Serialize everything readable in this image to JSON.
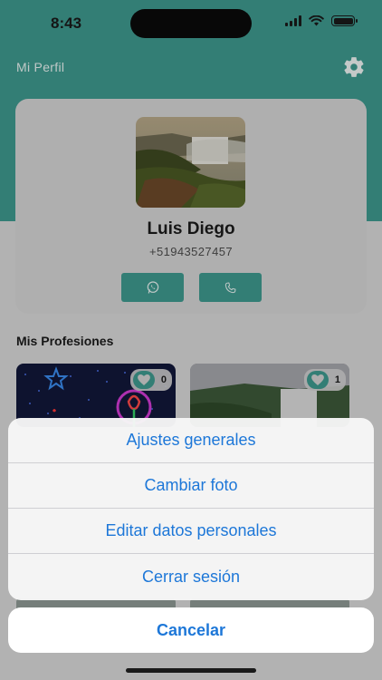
{
  "status_bar": {
    "time": "8:43"
  },
  "header": {
    "title": "Mi Perfil",
    "settings_icon": "gear-icon"
  },
  "profile": {
    "name": "Luis Diego",
    "phone": "+51943527457",
    "photo_icon": "landscape-waterfall-photo",
    "whatsapp_icon": "whatsapp-icon",
    "call_icon": "phone-icon"
  },
  "professions": {
    "title": "Mis Profesiones",
    "items": [
      {
        "likes": "0",
        "image": "neon-rose-photo"
      },
      {
        "likes": "1",
        "image": "waterfall-photo"
      }
    ]
  },
  "action_sheet": {
    "items": [
      {
        "label": "Ajustes generales"
      },
      {
        "label": "Cambiar foto"
      },
      {
        "label": "Editar datos personales"
      },
      {
        "label": "Cerrar sesión"
      }
    ],
    "cancel_label": "Cancelar"
  },
  "colors": {
    "accent": "#3f9a8f",
    "ios_blue": "#1d77d8"
  }
}
